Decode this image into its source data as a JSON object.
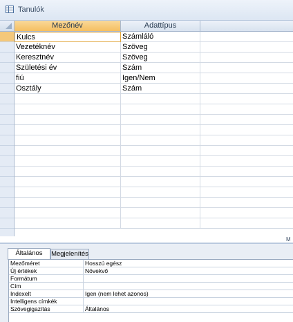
{
  "window": {
    "title": "Tanulók"
  },
  "table_headers": {
    "field_name": "Mezőnév",
    "data_type": "Adattípus",
    "description": ""
  },
  "fields": [
    {
      "name": "Kulcs",
      "type": "Számláló"
    },
    {
      "name": "Vezetéknév",
      "type": "Szöveg"
    },
    {
      "name": "Keresztnév",
      "type": "Szöveg"
    },
    {
      "name": "Születési év",
      "type": "Szám"
    },
    {
      "name": "fiú",
      "type": "Igen/Nem"
    },
    {
      "name": "Osztály",
      "type": "Szám"
    }
  ],
  "current_row_index": 0,
  "scroll_tag": "M",
  "properties": {
    "tabs": {
      "general": "Általános",
      "display": "Megjelenítés"
    },
    "active_tab": "general",
    "rows": [
      {
        "name": "Mezőméret",
        "value": "Hosszú egész"
      },
      {
        "name": "Új értékek",
        "value": "Növekvő"
      },
      {
        "name": "Formátum",
        "value": ""
      },
      {
        "name": "Cím",
        "value": ""
      },
      {
        "name": "Indexelt",
        "value": "Igen (nem lehet azonos)"
      },
      {
        "name": "Intelligens címkék",
        "value": ""
      },
      {
        "name": "Szövegigazítás",
        "value": "Általános"
      }
    ]
  },
  "colors": {
    "selected_header": "#f5bf60",
    "header": "#d8e2ef",
    "accent": "#e2a63d"
  },
  "icons": {
    "table": "table-icon"
  }
}
